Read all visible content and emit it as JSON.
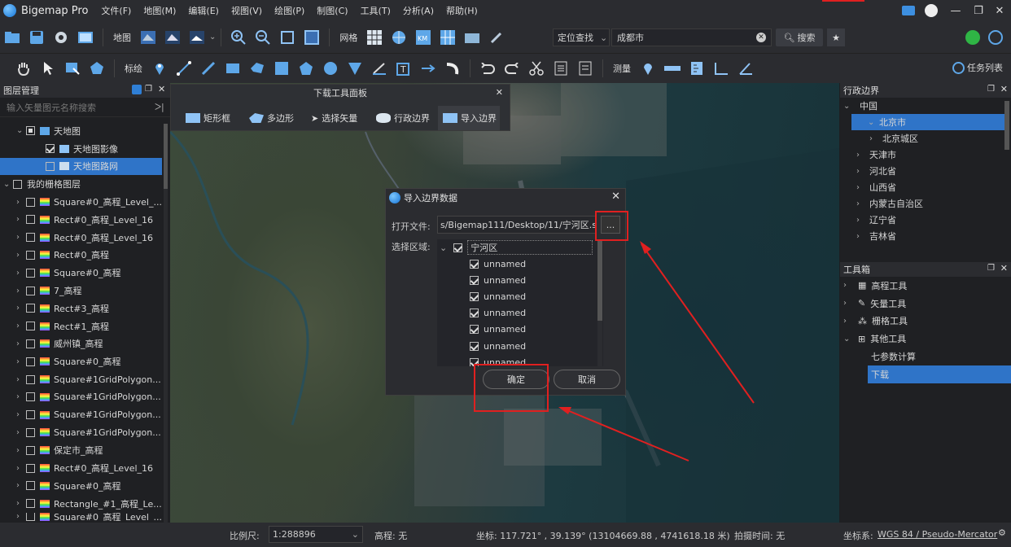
{
  "app": {
    "title": "Bigemap Pro"
  },
  "menu": [
    "文件(F)",
    "地图(M)",
    "编辑(E)",
    "视图(V)",
    "绘图(P)",
    "制图(C)",
    "工具(T)",
    "分析(A)",
    "帮助(H)"
  ],
  "toolbar": {
    "map_label": "地图",
    "grid_label": "网格",
    "locate_label": "定位查找",
    "search_value": "成都市",
    "search_btn": "搜索",
    "label_label": "标绘",
    "measure_label": "测量",
    "tasks_label": "任务列表"
  },
  "layers": {
    "title": "图层管理",
    "search_placeholder": "输入矢量图元名称搜索",
    "items": [
      "天地图",
      "天地图影像",
      "天地图路网",
      "我的栅格图层",
      "Square#0_高程_Level_...",
      "Rect#0_高程_Level_16",
      "Rect#0_高程_Level_16",
      "Rect#0_高程",
      "Square#0_高程",
      "7_高程",
      "Rect#3_高程",
      "Rect#1_高程",
      "威州镇_高程",
      "Square#0_高程",
      "Square#1GridPolygon...",
      "Square#1GridPolygon...",
      "Square#1GridPolygon...",
      "Square#1GridPolygon...",
      "保定市_高程",
      "Rect#0_高程_Level_16",
      "Square#0_高程",
      "Rectangle_#1_高程_Le...",
      "Square#0_高程_Level_..."
    ]
  },
  "download_panel": {
    "title": "下载工具面板",
    "tools": [
      "矩形框",
      "多边形",
      "选择矢量",
      "行政边界",
      "导入边界"
    ]
  },
  "dialog": {
    "title": "导入边界数据",
    "open_file_label": "打开文件:",
    "file_path": "s/Bigemap111/Desktop/11/宁河区.shp",
    "browse": "...",
    "region_label": "选择区域:",
    "root": "宁河区",
    "children": [
      "unnamed",
      "unnamed",
      "unnamed",
      "unnamed",
      "unnamed",
      "unnamed",
      "unnamed"
    ],
    "ok": "确定",
    "cancel": "取消"
  },
  "admin": {
    "title": "行政边界",
    "items": [
      "中国",
      "北京市",
      "北京城区",
      "天津市",
      "河北省",
      "山西省",
      "内蒙古自治区",
      "辽宁省",
      "吉林省"
    ]
  },
  "toolbox": {
    "title": "工具箱",
    "items": [
      "高程工具",
      "矢量工具",
      "栅格工具",
      "其他工具",
      "七参数计算",
      "下载"
    ]
  },
  "status": {
    "scale_label": "比例尺:",
    "scale_value": "1:288896",
    "elev": "高程:  无",
    "coords": "坐标:  117.721° , 39.139°  (13104669.88 , 4741618.18 米)",
    "shot_time": "拍摄时间:  无",
    "crs_label": "坐标系:",
    "crs_value": "WGS 84 / Pseudo-Mercator"
  },
  "colors": {
    "accent": "#2f7fd6",
    "highlight": "#2f74c8",
    "red": "#e02020"
  }
}
